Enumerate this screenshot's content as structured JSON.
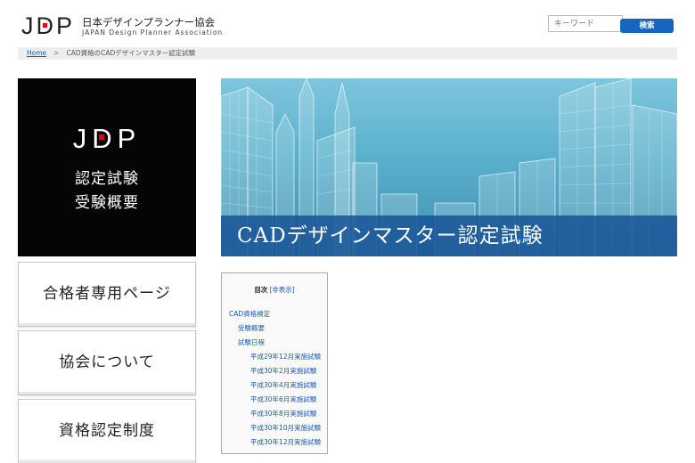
{
  "header": {
    "logo_mark": "JDP",
    "logo_jp": "日本デザインプランナー協会",
    "logo_en": "JAPAN Design Planner Association",
    "search_placeholder": "キーワード",
    "search_button": "検索"
  },
  "breadcrumb": {
    "home": "Home",
    "separator": ">",
    "current": "CAD資格のCADデザインマスター認定試験"
  },
  "sidebar": {
    "hero": {
      "logo_mark": "JDP",
      "line1": "認定試験",
      "line2": "受験概要"
    },
    "buttons": [
      "合格者専用ページ",
      "協会について",
      "資格認定制度"
    ]
  },
  "banner": {
    "title": "CADデザインマスター認定試験"
  },
  "toc": {
    "heading": "目次",
    "toggle": "[非表示]",
    "items": [
      {
        "label": "CAD資格検定",
        "level": 1
      },
      {
        "label": "受験概要",
        "level": 2
      },
      {
        "label": "試験日程",
        "level": 2
      },
      {
        "label": "平成29年12月実施試験",
        "level": 3
      },
      {
        "label": "平成30年2月実施試験",
        "level": 3
      },
      {
        "label": "平成30年4月実施試験",
        "level": 3
      },
      {
        "label": "平成30年6月実施試験",
        "level": 3
      },
      {
        "label": "平成30年8月実施試験",
        "level": 3
      },
      {
        "label": "平成30年10月実施試験",
        "level": 3
      },
      {
        "label": "平成30年12月実施試験",
        "level": 3
      }
    ]
  },
  "colors": {
    "accent_blue": "#1666c1",
    "logo_red": "#e60012",
    "link": "#1a5ab5"
  }
}
